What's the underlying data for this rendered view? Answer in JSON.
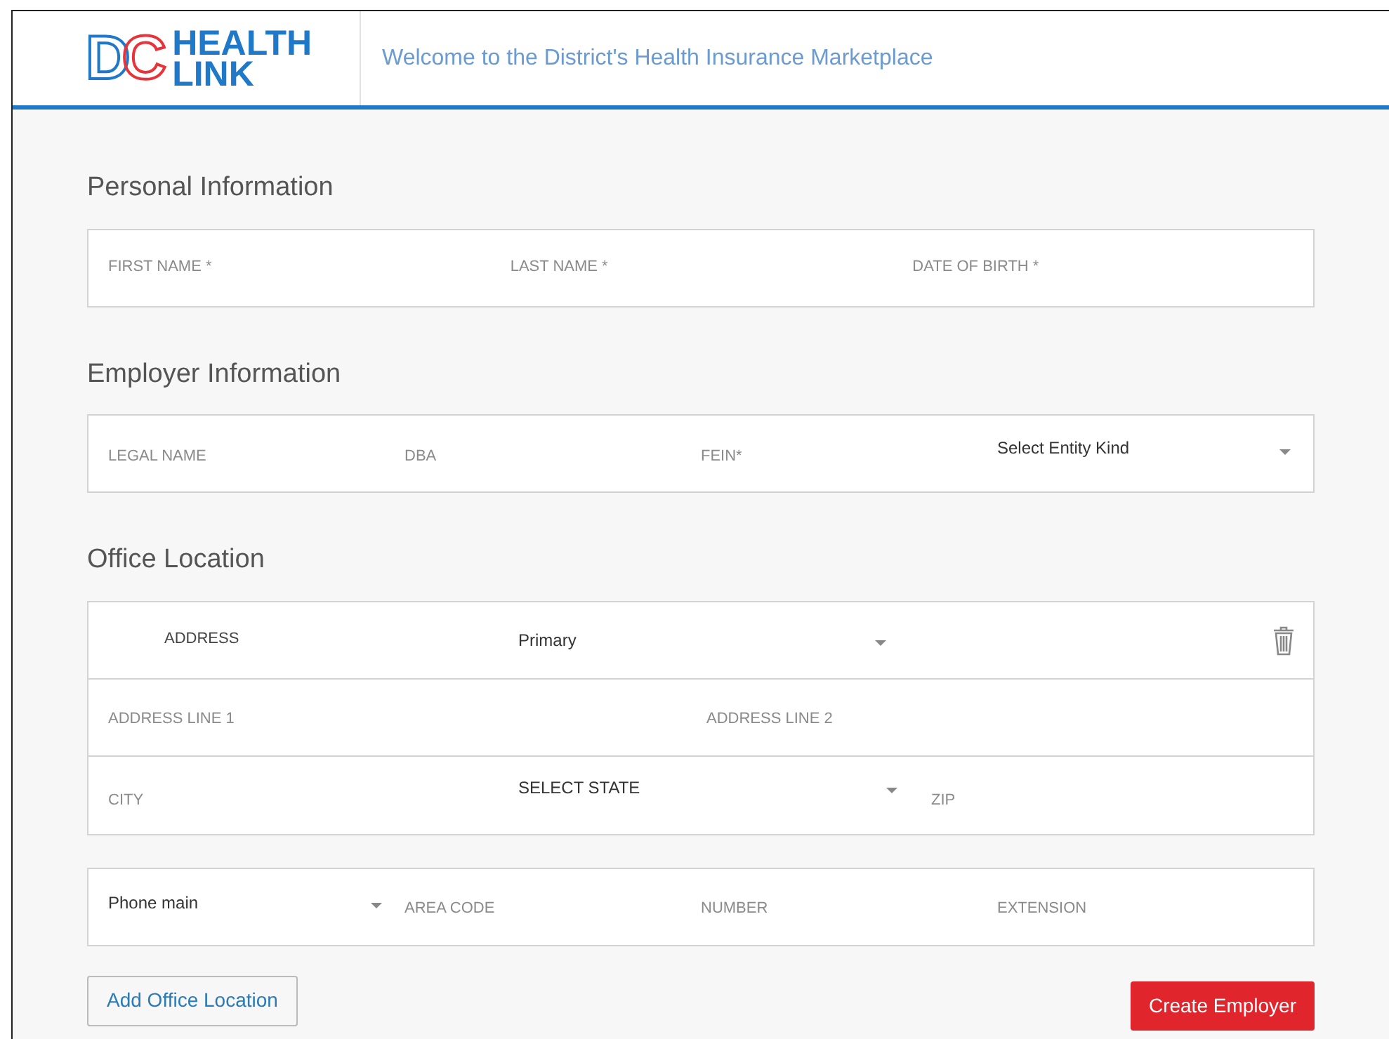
{
  "header": {
    "logo": {
      "letters": [
        "D",
        "C"
      ],
      "words": [
        "HEALTH",
        "LINK"
      ]
    },
    "tagline": "Welcome to the District's Health Insurance Marketplace"
  },
  "personal": {
    "title": "Personal Information",
    "first_name": {
      "placeholder": "FIRST NAME *"
    },
    "last_name": {
      "placeholder": "LAST NAME *"
    },
    "date_of_birth": {
      "placeholder": "DATE OF BIRTH *"
    }
  },
  "employer": {
    "title": "Employer Information",
    "legal_name": {
      "placeholder": "LEGAL NAME"
    },
    "dba": {
      "placeholder": "DBA"
    },
    "fein": {
      "placeholder": "FEIN*"
    },
    "entity_kind": {
      "value": "Select Entity Kind"
    }
  },
  "office": {
    "title": "Office Location",
    "address_label": "ADDRESS",
    "address_kind": {
      "value": "Primary"
    },
    "address_line_1": {
      "placeholder": "ADDRESS LINE 1"
    },
    "address_line_2": {
      "placeholder": "ADDRESS LINE 2"
    },
    "city": {
      "placeholder": "CITY"
    },
    "state": {
      "value": "SELECT STATE"
    },
    "zip": {
      "placeholder": "ZIP"
    }
  },
  "phone": {
    "kind": {
      "value": "Phone main"
    },
    "area_code": {
      "placeholder": "AREA CODE"
    },
    "number": {
      "placeholder": "NUMBER"
    },
    "extension": {
      "placeholder": "EXTENSION"
    }
  },
  "buttons": {
    "add_office_location": "Add Office Location",
    "create_employer": "Create Employer"
  }
}
